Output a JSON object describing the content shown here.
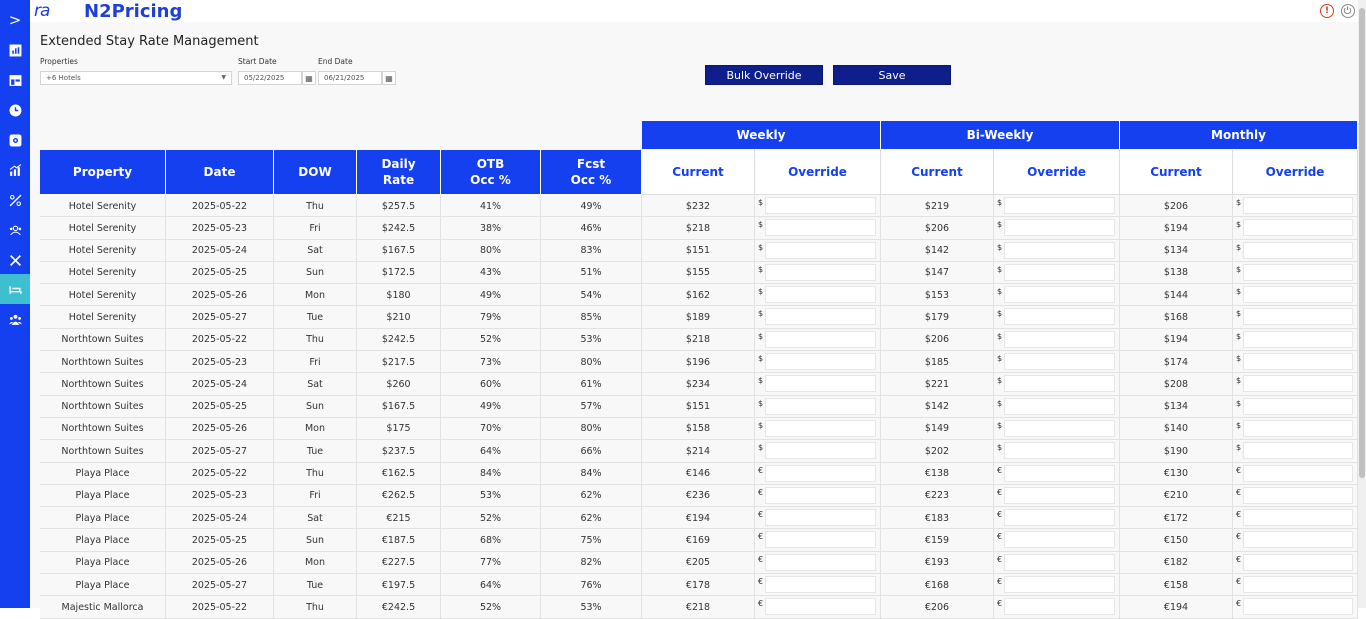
{
  "app": {
    "logo_text": "ra",
    "title": "N2Pricing"
  },
  "sidebar": {
    "items": [
      {
        "icon": "chevron-right-icon",
        "glyph": ">"
      },
      {
        "icon": "chart-icon"
      },
      {
        "icon": "layout-icon"
      },
      {
        "icon": "clock-icon"
      },
      {
        "icon": "gear-box-icon"
      },
      {
        "icon": "bar-chart-icon"
      },
      {
        "icon": "percent-icon"
      },
      {
        "icon": "group-icon"
      },
      {
        "icon": "tools-icon"
      },
      {
        "icon": "bed-icon",
        "active": true
      },
      {
        "icon": "people-icon"
      }
    ]
  },
  "page": {
    "title": "Extended Stay Rate Management",
    "properties_label": "Properties",
    "properties_value": "+6 Hotels",
    "start_label": "Start Date",
    "start_value": "05/22/2025",
    "end_label": "End Date",
    "end_value": "06/21/2025",
    "bulk_override_label": "Bulk Override",
    "save_label": "Save"
  },
  "table": {
    "group_headers": {
      "weekly": "Weekly",
      "biweekly": "Bi-Weekly",
      "monthly": "Monthly"
    },
    "columns": {
      "property": "Property",
      "date": "Date",
      "dow": "DOW",
      "daily_rate_1": "Daily",
      "daily_rate_2": "Rate",
      "otb_1": "OTB",
      "otb_2": "Occ %",
      "fcst_1": "Fcst",
      "fcst_2": "Occ %",
      "current": "Current",
      "override": "Override"
    },
    "rows": [
      {
        "property": "Hotel Serenity",
        "date": "2025-05-22",
        "dow": "Thu",
        "rate": "$257.5",
        "otb": "41%",
        "fcst": "49%",
        "w": "$232",
        "b": "$219",
        "m": "$206",
        "cur": "$"
      },
      {
        "property": "Hotel Serenity",
        "date": "2025-05-23",
        "dow": "Fri",
        "rate": "$242.5",
        "otb": "38%",
        "fcst": "46%",
        "w": "$218",
        "b": "$206",
        "m": "$194",
        "cur": "$"
      },
      {
        "property": "Hotel Serenity",
        "date": "2025-05-24",
        "dow": "Sat",
        "rate": "$167.5",
        "otb": "80%",
        "fcst": "83%",
        "w": "$151",
        "b": "$142",
        "m": "$134",
        "cur": "$"
      },
      {
        "property": "Hotel Serenity",
        "date": "2025-05-25",
        "dow": "Sun",
        "rate": "$172.5",
        "otb": "43%",
        "fcst": "51%",
        "w": "$155",
        "b": "$147",
        "m": "$138",
        "cur": "$"
      },
      {
        "property": "Hotel Serenity",
        "date": "2025-05-26",
        "dow": "Mon",
        "rate": "$180",
        "otb": "49%",
        "fcst": "54%",
        "w": "$162",
        "b": "$153",
        "m": "$144",
        "cur": "$"
      },
      {
        "property": "Hotel Serenity",
        "date": "2025-05-27",
        "dow": "Tue",
        "rate": "$210",
        "otb": "79%",
        "fcst": "85%",
        "w": "$189",
        "b": "$179",
        "m": "$168",
        "cur": "$"
      },
      {
        "property": "Northtown Suites",
        "date": "2025-05-22",
        "dow": "Thu",
        "rate": "$242.5",
        "otb": "52%",
        "fcst": "53%",
        "w": "$218",
        "b": "$206",
        "m": "$194",
        "cur": "$"
      },
      {
        "property": "Northtown Suites",
        "date": "2025-05-23",
        "dow": "Fri",
        "rate": "$217.5",
        "otb": "73%",
        "fcst": "80%",
        "w": "$196",
        "b": "$185",
        "m": "$174",
        "cur": "$"
      },
      {
        "property": "Northtown Suites",
        "date": "2025-05-24",
        "dow": "Sat",
        "rate": "$260",
        "otb": "60%",
        "fcst": "61%",
        "w": "$234",
        "b": "$221",
        "m": "$208",
        "cur": "$"
      },
      {
        "property": "Northtown Suites",
        "date": "2025-05-25",
        "dow": "Sun",
        "rate": "$167.5",
        "otb": "49%",
        "fcst": "57%",
        "w": "$151",
        "b": "$142",
        "m": "$134",
        "cur": "$"
      },
      {
        "property": "Northtown Suites",
        "date": "2025-05-26",
        "dow": "Mon",
        "rate": "$175",
        "otb": "70%",
        "fcst": "80%",
        "w": "$158",
        "b": "$149",
        "m": "$140",
        "cur": "$"
      },
      {
        "property": "Northtown Suites",
        "date": "2025-05-27",
        "dow": "Tue",
        "rate": "$237.5",
        "otb": "64%",
        "fcst": "66%",
        "w": "$214",
        "b": "$202",
        "m": "$190",
        "cur": "$"
      },
      {
        "property": "Playa Place",
        "date": "2025-05-22",
        "dow": "Thu",
        "rate": "€162.5",
        "otb": "84%",
        "fcst": "84%",
        "w": "€146",
        "b": "€138",
        "m": "€130",
        "cur": "€"
      },
      {
        "property": "Playa Place",
        "date": "2025-05-23",
        "dow": "Fri",
        "rate": "€262.5",
        "otb": "53%",
        "fcst": "62%",
        "w": "€236",
        "b": "€223",
        "m": "€210",
        "cur": "€"
      },
      {
        "property": "Playa Place",
        "date": "2025-05-24",
        "dow": "Sat",
        "rate": "€215",
        "otb": "52%",
        "fcst": "62%",
        "w": "€194",
        "b": "€183",
        "m": "€172",
        "cur": "€"
      },
      {
        "property": "Playa Place",
        "date": "2025-05-25",
        "dow": "Sun",
        "rate": "€187.5",
        "otb": "68%",
        "fcst": "75%",
        "w": "€169",
        "b": "€159",
        "m": "€150",
        "cur": "€"
      },
      {
        "property": "Playa Place",
        "date": "2025-05-26",
        "dow": "Mon",
        "rate": "€227.5",
        "otb": "77%",
        "fcst": "82%",
        "w": "€205",
        "b": "€193",
        "m": "€182",
        "cur": "€"
      },
      {
        "property": "Playa Place",
        "date": "2025-05-27",
        "dow": "Tue",
        "rate": "€197.5",
        "otb": "64%",
        "fcst": "76%",
        "w": "€178",
        "b": "€168",
        "m": "€158",
        "cur": "€"
      },
      {
        "property": "Majestic Mallorca",
        "date": "2025-05-22",
        "dow": "Thu",
        "rate": "€242.5",
        "otb": "52%",
        "fcst": "53%",
        "w": "€218",
        "b": "€206",
        "m": "€194",
        "cur": "€"
      }
    ]
  }
}
